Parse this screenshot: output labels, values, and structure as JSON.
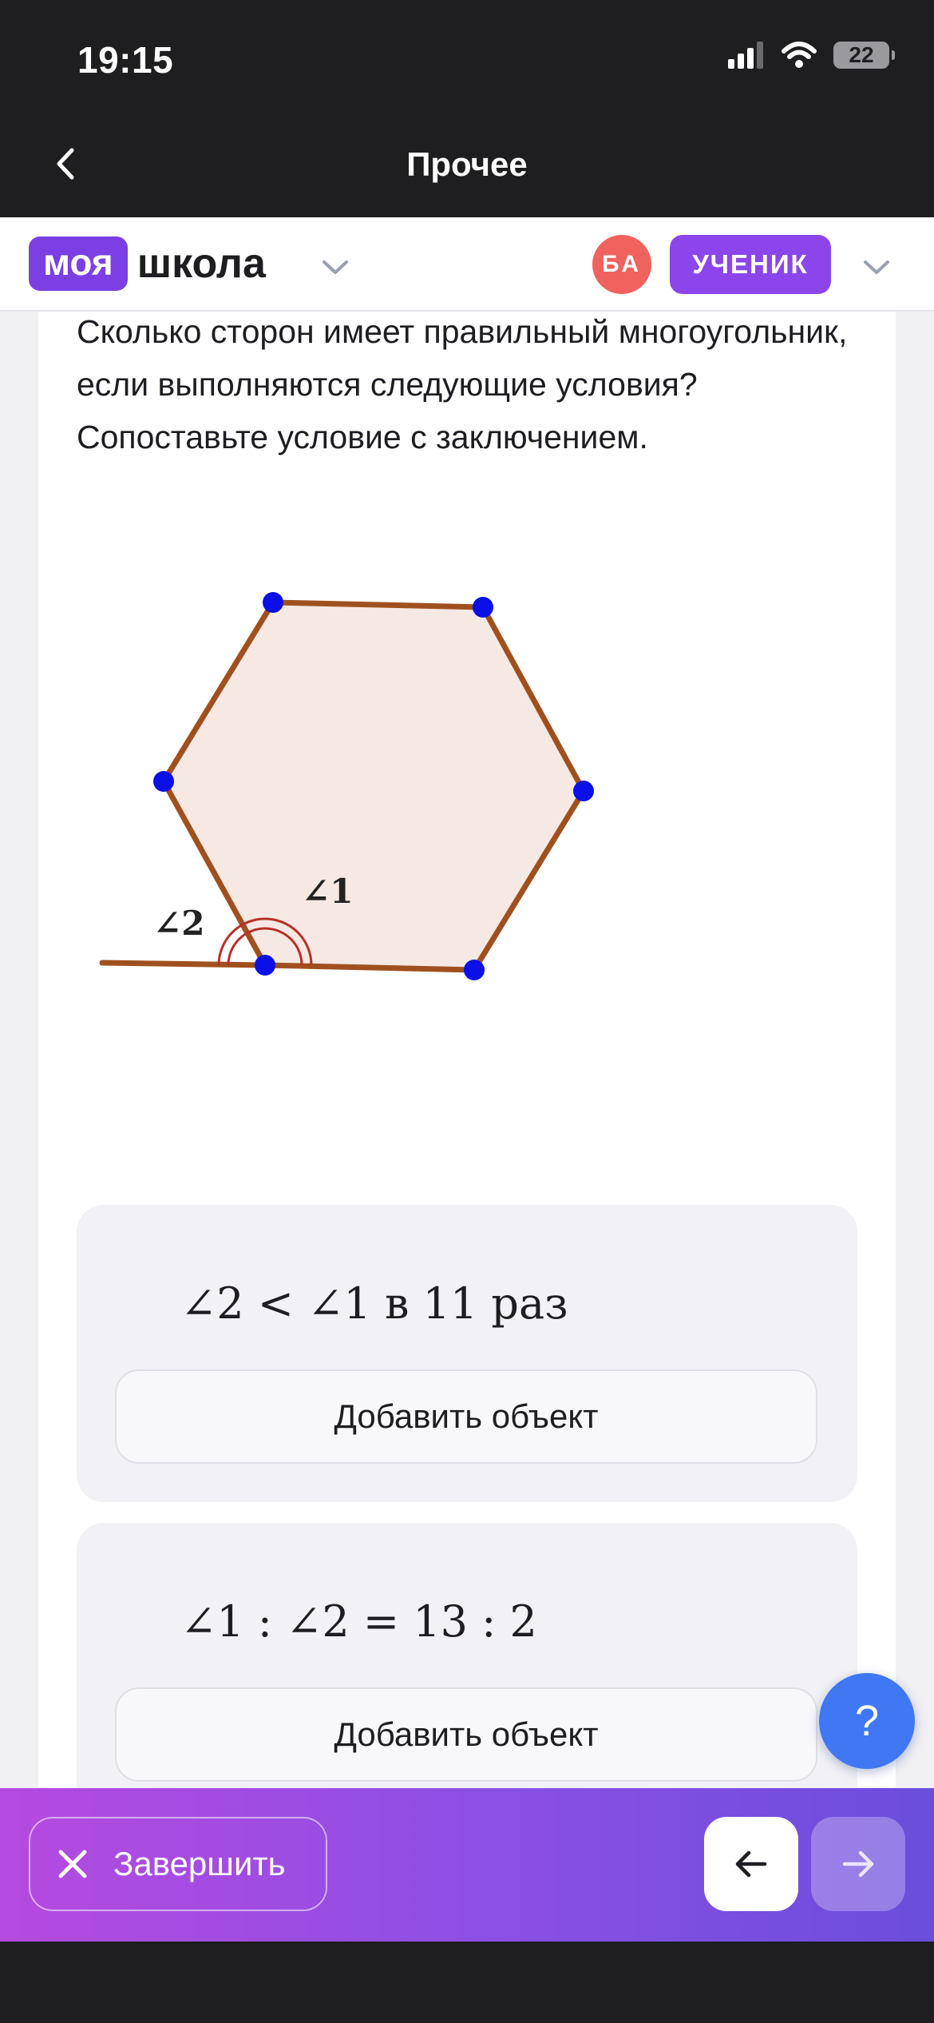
{
  "status_bar": {
    "time": "19:15",
    "battery": "22"
  },
  "nav": {
    "title": "Прочее"
  },
  "app_header": {
    "logo_badge": "моя",
    "logo_text": "школа",
    "avatar_initials": "БА",
    "role_label": "УЧЕНИК"
  },
  "question": {
    "text": "Сколько сторон имеет правильный многоугольник, если выполняются следующие условия? Сопоставьте условие с заключением."
  },
  "figure": {
    "angle1_label": "∠1",
    "angle2_label": "∠2"
  },
  "matches": [
    {
      "condition": "∠2 < ∠1 в 11 раз",
      "button": "Добавить объект"
    },
    {
      "condition": "∠1 : ∠2 = 13 : 2",
      "button": "Добавить объект"
    }
  ],
  "help": {
    "label": "?"
  },
  "bottom_bar": {
    "finish_label": "Завершить"
  },
  "colors": {
    "accent": "#8b45ea",
    "help": "#3f78f2",
    "polygon_stroke": "#a0501e",
    "vertex": "#0a10e6"
  }
}
